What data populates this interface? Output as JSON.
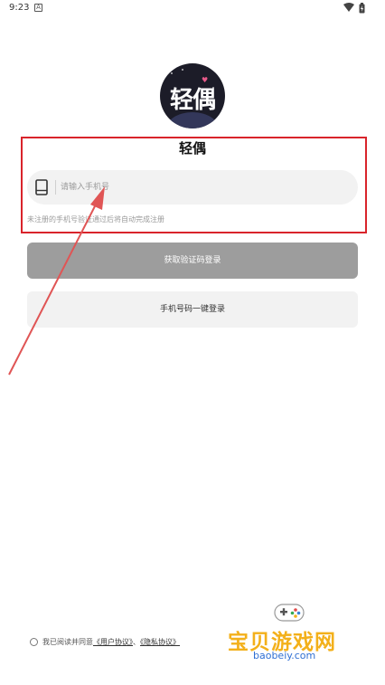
{
  "status_bar": {
    "time": "9:23",
    "notification_icon": "A"
  },
  "app": {
    "logo_text": "轻偶",
    "name": "轻偶"
  },
  "login": {
    "phone_placeholder": "请输入手机号",
    "phone_value": "",
    "register_hint": "未注册的手机号验证通过后将自动完成注册",
    "get_code_button": "获取验证码登录",
    "one_key_button": "手机号码一键登录"
  },
  "agreement": {
    "prefix": "我已阅读并同意",
    "user_agreement": "《用户协议》",
    "separator": "、",
    "privacy_agreement": "《隐私协议》"
  },
  "watermark": {
    "name": "宝贝游戏网",
    "site": "baobeiy.com"
  },
  "colors": {
    "annotation_red": "#d9242b",
    "button_gray": "#9d9d9d",
    "field_bg": "#f2f2f2"
  },
  "icons": [
    "phone-icon",
    "wifi-icon",
    "battery-icon",
    "gamepad-icon"
  ]
}
